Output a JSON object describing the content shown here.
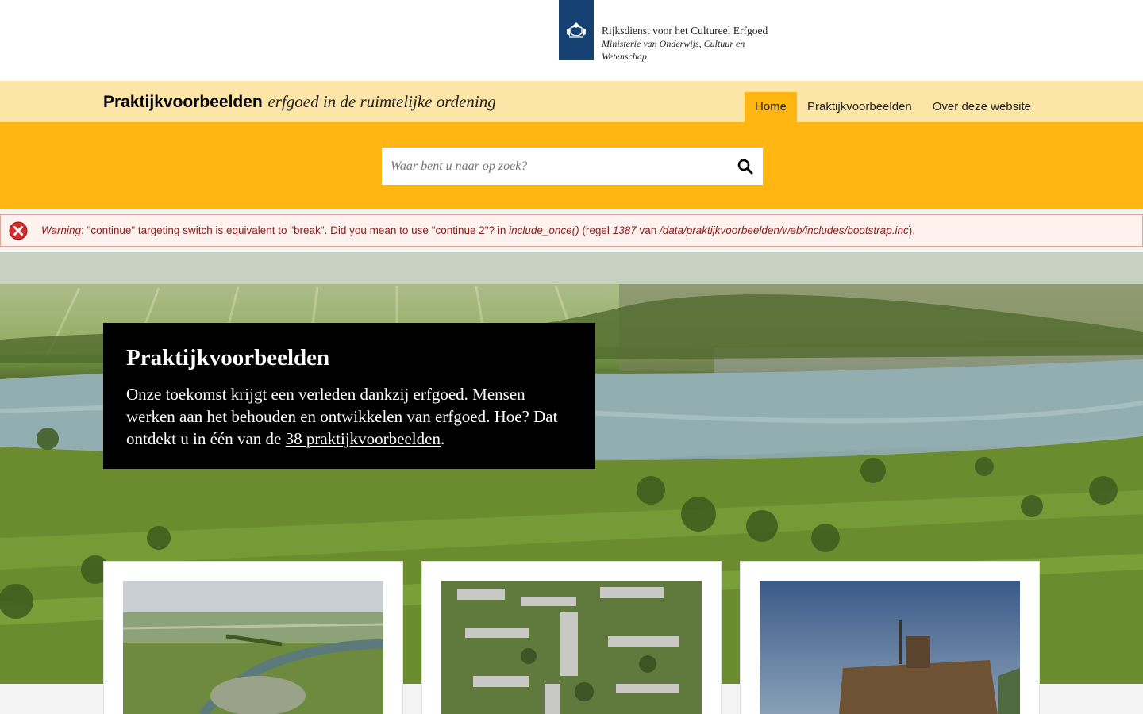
{
  "logo": {
    "line1": "Rijksdienst voor het Cultureel Erfgoed",
    "line2": "Ministerie van Onderwijs, Cultuur en Wetenschap"
  },
  "header": {
    "title_bold": "Praktijkvoorbeelden",
    "title_sub": "erfgoed in de ruimtelijke ordening",
    "nav": [
      {
        "label": "Home",
        "active": true
      },
      {
        "label": "Praktijkvoorbeelden",
        "active": false
      },
      {
        "label": "Over deze website",
        "active": false
      }
    ]
  },
  "search": {
    "placeholder": "Waar bent u naar op zoek?"
  },
  "warning": {
    "label": "Warning",
    "message": ": \"continue\" targeting switch is equivalent to \"break\". Did you mean to use \"continue 2\"? in ",
    "function": "include_once()",
    "line_text": " (regel ",
    "line_number": "1387",
    "van_text": " van ",
    "path": "/data/praktijkvoorbeelden/web/includes/bootstrap.inc",
    "end": ")."
  },
  "intro": {
    "title": "Praktijkvoorbeelden",
    "body_before": "Onze toekomst krijgt een verleden dankzij erfgoed. Mensen werken aan het behouden en ontwikkelen van erfgoed. Hoe? Dat ontdekt u in één van de ",
    "link": "38 praktijkvoorbeelden",
    "body_after": "."
  },
  "colors": {
    "accent": "#ffb612",
    "header_bg": "#fde5a7",
    "logo_blue": "#154273",
    "warning_text": "#8b1c1c"
  },
  "cards": [
    {
      "image": "aerial-fort-river-photo"
    },
    {
      "image": "aerial-residential-district-photo"
    },
    {
      "image": "atlantikwall-bunker-photo"
    }
  ]
}
